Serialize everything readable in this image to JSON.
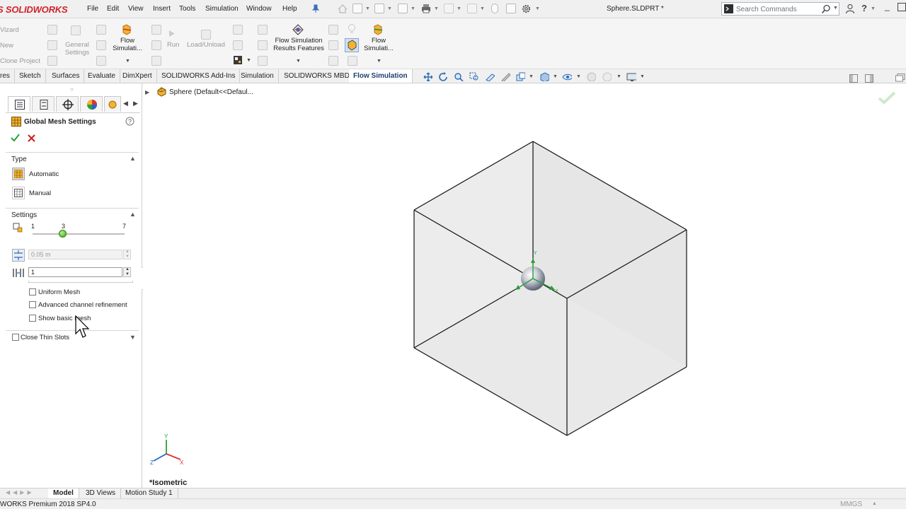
{
  "app": {
    "logo_text": "S SOLIDWORKS",
    "document_title": "Sphere.SLDPRT *",
    "brand_color": "#d2232a",
    "accent_color": "#1d3f6e"
  },
  "menu": [
    "File",
    "Edit",
    "View",
    "Insert",
    "Tools",
    "Simulation",
    "Window",
    "Help"
  ],
  "search": {
    "placeholder": "Search Commands",
    "icon": "search-icon"
  },
  "command_manager": {
    "left_items": [
      "Vizard",
      "New",
      "Clone Project"
    ],
    "general_settings": "General Settings",
    "flow_sim_1": "Flow Simulati...",
    "run": "Run",
    "load_unload": "Load/Unload",
    "results_features_line1": "Flow Simulation",
    "results_features_line2": "Results Features",
    "flow_sim_2": "Flow Simulati..."
  },
  "tabs": [
    "res",
    "Sketch",
    "Surfaces",
    "Evaluate",
    "DimXpert",
    "SOLIDWORKS Add-Ins",
    "Simulation",
    "SOLIDWORKS MBD",
    "Flow Simulation"
  ],
  "active_tab": "Flow Simulation",
  "feature_tree": {
    "root_label": "Sphere  (Default<<Defaul..."
  },
  "property_manager": {
    "title": "Global Mesh Settings",
    "type_section": "Type",
    "type_options": [
      "Automatic",
      "Manual"
    ],
    "settings_section": "Settings",
    "slider": {
      "min_label": "1",
      "value_label": "3",
      "max_label": "7",
      "value": 3,
      "min": 1,
      "max": 7
    },
    "min_gap_value": "0.05 m",
    "min_wall_value": "1",
    "checkboxes": [
      "Uniform Mesh",
      "Advanced channel refinement",
      "Show basic mesh"
    ],
    "close_thin_slots": "Close Thin Slots"
  },
  "viewport": {
    "view_label": "*Isometric",
    "axis_labels": {
      "y": "Y",
      "x": "X",
      "z": "Z"
    }
  },
  "bottom_tabs": [
    "Model",
    "3D Views",
    "Motion Study 1"
  ],
  "active_bottom_tab": "Model",
  "status": {
    "left": "WORKS Premium 2018 SP4.0",
    "units": "MMGS"
  }
}
